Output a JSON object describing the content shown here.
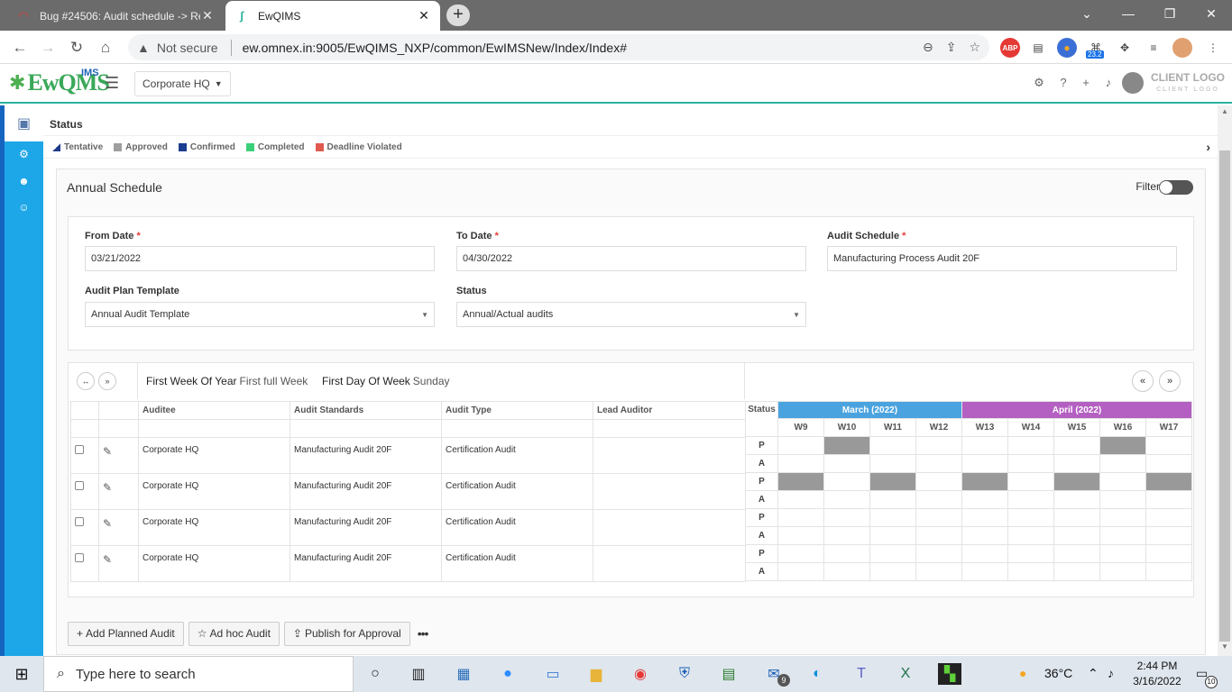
{
  "browser": {
    "tabs": [
      {
        "title": "Bug #24506: Audit schedule -> Re",
        "active": false
      },
      {
        "title": "EwQIMS",
        "active": true
      }
    ],
    "not_secure": "Not secure",
    "url": "ew.omnex.in:9005/EwQIMS_NXP/common/EwIMSNew/Index/Index#",
    "ext_badge": "23.2"
  },
  "app": {
    "logo_main": "EwQMS",
    "logo_ims": "IMS",
    "site": "Corporate HQ",
    "client_logo": "CLIENT LOGO",
    "client_logo_sub": "CLIENT LOGO"
  },
  "status": {
    "label": "Status",
    "legend": [
      {
        "label": "Tentative",
        "color": "#1e3a8a"
      },
      {
        "label": "Approved",
        "color": "#9e9e9e"
      },
      {
        "label": "Confirmed",
        "color": "#1a3d8f"
      },
      {
        "label": "Completed",
        "color": "#3ccf7a"
      },
      {
        "label": "Deadline Violated",
        "color": "#e05a4f"
      }
    ]
  },
  "panel": {
    "title": "Annual Schedule",
    "filter_label": "Filter"
  },
  "form": {
    "from_date_label": "From Date",
    "from_date": "03/21/2022",
    "to_date_label": "To Date",
    "to_date": "04/30/2022",
    "audit_schedule_label": "Audit Schedule",
    "audit_schedule": "Manufacturing Process Audit 20F",
    "plan_template_label": "Audit Plan Template",
    "plan_template": "Annual Audit Template",
    "status_label": "Status",
    "status": "Annual/Actual audits",
    "required": "*"
  },
  "grid": {
    "first_week_label": "First Week Of Year",
    "first_week_value": "First full Week",
    "first_day_label": "First Day Of Week",
    "first_day_value": "Sunday",
    "columns": [
      "Auditee",
      "Audit Standards",
      "Audit Type",
      "Lead Auditor"
    ],
    "rows": [
      {
        "auditee": "Corporate HQ",
        "standard": "Manufacturing Audit 20F",
        "type": "Certification Audit",
        "lead": ""
      },
      {
        "auditee": "Corporate HQ",
        "standard": "Manufacturing Audit 20F",
        "type": "Certification Audit",
        "lead": ""
      },
      {
        "auditee": "Corporate HQ",
        "standard": "Manufacturing Audit 20F",
        "type": "Certification Audit",
        "lead": ""
      },
      {
        "auditee": "Corporate HQ",
        "standard": "Manufacturing Audit 20F",
        "type": "Certification Audit",
        "lead": ""
      }
    ],
    "status_col": "Status",
    "months": [
      {
        "label": "March (2022)",
        "color": "#4aa3df",
        "weeks": [
          "W9",
          "W10",
          "W11",
          "W12"
        ]
      },
      {
        "label": "April (2022)",
        "color": "#b45fc2",
        "weeks": [
          "W13",
          "W14",
          "W15",
          "W16",
          "W17"
        ]
      }
    ],
    "plan_label": "P",
    "actual_label": "A",
    "schedule": [
      {
        "P": [
          0,
          1,
          0,
          0,
          0,
          0,
          0,
          1,
          0
        ],
        "A": [
          0,
          0,
          0,
          0,
          0,
          0,
          0,
          0,
          0
        ]
      },
      {
        "P": [
          1,
          0,
          1,
          0,
          1,
          0,
          1,
          0,
          1
        ],
        "A": [
          0,
          0,
          0,
          0,
          0,
          0,
          0,
          0,
          0
        ]
      },
      {
        "P": [
          0,
          0,
          0,
          0,
          0,
          0,
          0,
          0,
          0
        ],
        "A": [
          0,
          0,
          0,
          0,
          0,
          0,
          0,
          0,
          0
        ]
      },
      {
        "P": [
          0,
          0,
          0,
          0,
          0,
          0,
          0,
          0,
          0
        ],
        "A": [
          0,
          0,
          0,
          0,
          0,
          0,
          0,
          0,
          0
        ]
      }
    ]
  },
  "actions": {
    "add_planned": "Add Planned Audit",
    "ad_hoc": "Ad hoc Audit",
    "publish": "Publish for Approval"
  },
  "taskbar": {
    "search_placeholder": "Type here to search",
    "mail_badge": "9",
    "temperature": "36°C",
    "time": "2:44 PM",
    "date": "3/16/2022",
    "notif_badge": "10"
  }
}
